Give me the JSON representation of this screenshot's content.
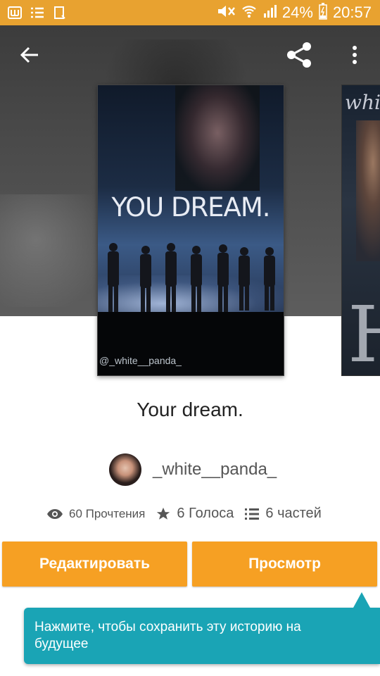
{
  "status_bar": {
    "battery": "24%",
    "time": "20:57",
    "icons": [
      "app-icon",
      "list-icon",
      "clipboard-icon",
      "mute-icon",
      "wifi-icon",
      "signal-icon",
      "battery-icon"
    ]
  },
  "toolbar": {
    "back_icon": "arrow-left",
    "share_icon": "share",
    "menu_icon": "more-vertical"
  },
  "cover": {
    "title_text": "YOU DREAM.",
    "signature": "@_white__panda_"
  },
  "next_cover": {
    "text_top": "white",
    "letter": "H"
  },
  "story": {
    "title": "Your dream.",
    "author": "_white__panda_"
  },
  "stats": {
    "reads": "60 Прочтения",
    "votes": "6 Голоса",
    "parts": "6 частей"
  },
  "buttons": {
    "edit": "Редактировать",
    "view": "Просмотр"
  },
  "tooltip": {
    "text": "Нажмите, чтобы сохранить эту историю на будущее"
  },
  "colors": {
    "status_bar": "#e8a230",
    "button": "#f6a023",
    "tooltip": "#1aa4b5"
  }
}
